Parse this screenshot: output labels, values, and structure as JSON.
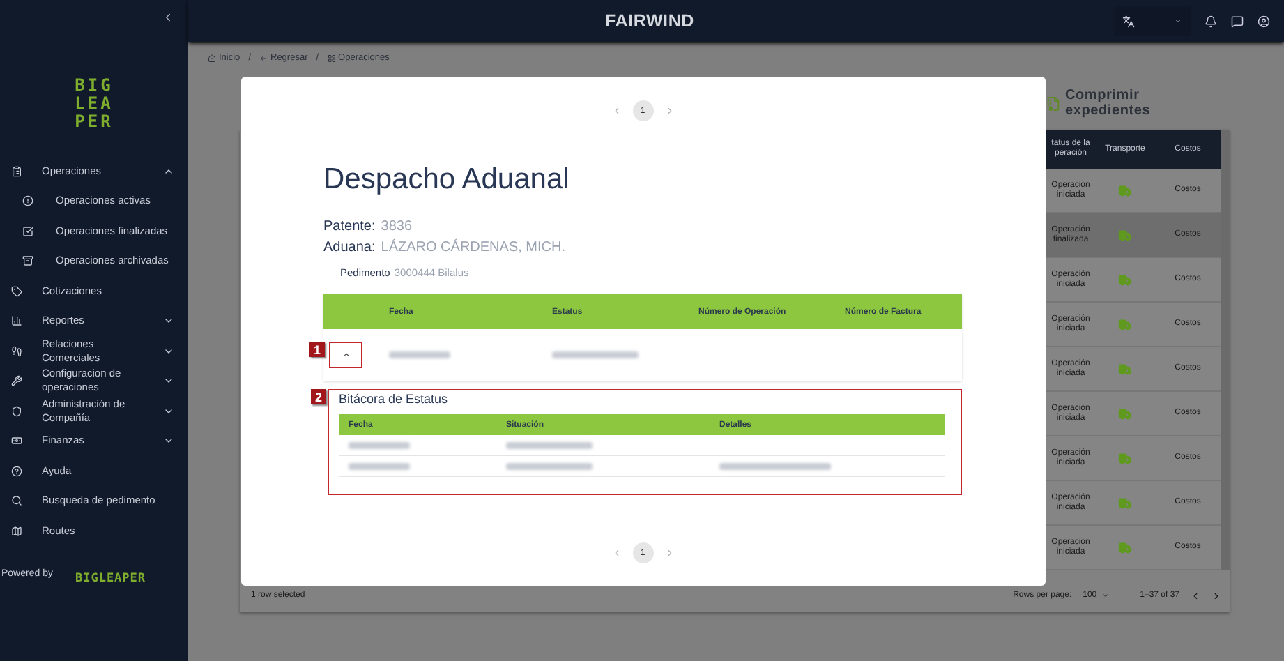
{
  "sidebar": {
    "logo_lines": [
      "BIG",
      "LEA",
      "PER"
    ],
    "items": [
      {
        "label": "Operaciones",
        "expanded": true,
        "children": [
          {
            "label": "Operaciones activas"
          },
          {
            "label": "Operaciones finalizadas"
          },
          {
            "label": "Operaciones archivadas"
          }
        ]
      },
      {
        "label": "Cotizaciones"
      },
      {
        "label": "Reportes",
        "expanded": false
      },
      {
        "label": "Relaciones Comerciales",
        "expanded": false
      },
      {
        "label": "Configuracion de operaciones",
        "expanded": false
      },
      {
        "label": "Administración de Compañía",
        "expanded": false
      },
      {
        "label": "Finanzas",
        "expanded": false
      },
      {
        "label": "Ayuda"
      },
      {
        "label": "Busqueda de pedimento"
      },
      {
        "label": "Routes"
      }
    ],
    "powered_by": "Powered by",
    "brand": "BIGLEAPER"
  },
  "header": {
    "title": "FAIRWIND"
  },
  "breadcrumb": [
    {
      "label": "Inicio"
    },
    {
      "separator": "/",
      "label": "Regresar"
    },
    {
      "separator": "/",
      "label": "Operaciones"
    }
  ],
  "background": {
    "action": "Comprimir expedientes",
    "columns": [
      "tatus de la peración",
      "Transporte",
      "Costos"
    ],
    "rows": [
      {
        "status": "Operación iniciada",
        "cost": "Costos",
        "selected": false
      },
      {
        "status": "Operación finalizada",
        "cost": "Costos",
        "selected": true
      },
      {
        "status": "Operación iniciada",
        "cost": "Costos",
        "selected": false
      },
      {
        "status": "Operación iniciada",
        "cost": "Costos",
        "selected": false
      },
      {
        "status": "Operación iniciada",
        "cost": "Costos",
        "selected": false
      },
      {
        "status": "Operación iniciada",
        "cost": "Costos",
        "selected": false
      },
      {
        "status": "Operación iniciada",
        "cost": "Costos",
        "selected": false
      },
      {
        "status": "Operación iniciada",
        "cost": "Costos",
        "selected": false
      },
      {
        "status": "Operación iniciada",
        "cost": "Costos",
        "selected": false
      }
    ],
    "footer": {
      "selection": "1 row selected",
      "rows_label": "Rows per page:",
      "rows_value": "100",
      "range": "1–37 of 37"
    }
  },
  "modal": {
    "pager_top": [
      {
        "label": "1",
        "selected": true
      }
    ],
    "title": "Despacho Aduanal",
    "fields": [
      {
        "label": "Patente:",
        "value": "3836"
      },
      {
        "label": "Aduana:",
        "value": "LÁZARO CÁRDENAS, MICH."
      }
    ],
    "pedimento": {
      "label": "Pedimento",
      "value": "3000444 Bilalus"
    },
    "table": {
      "columns": [
        "Fecha",
        "Estatus",
        "Número de Operación",
        "Número de Factura"
      ],
      "rows": [
        {
          "expanded": true,
          "annotation": "1",
          "cells": [
            {
              "kind": "redacted"
            },
            {
              "kind": "redacted"
            },
            {
              "kind": "empty"
            },
            {
              "kind": "empty"
            }
          ]
        }
      ]
    },
    "log": {
      "annotation": "2",
      "title": "Bitácora de Estatus",
      "columns": [
        "Fecha",
        "Situación",
        "Detalles"
      ],
      "rows": [
        {
          "cells": [
            {
              "kind": "redacted"
            },
            {
              "kind": "redacted"
            },
            {
              "kind": "empty"
            }
          ]
        },
        {
          "cells": [
            {
              "kind": "redacted"
            },
            {
              "kind": "redacted"
            },
            {
              "kind": "redacted"
            }
          ]
        }
      ]
    },
    "pager_bottom": [
      {
        "label": "1",
        "selected": true
      }
    ]
  }
}
